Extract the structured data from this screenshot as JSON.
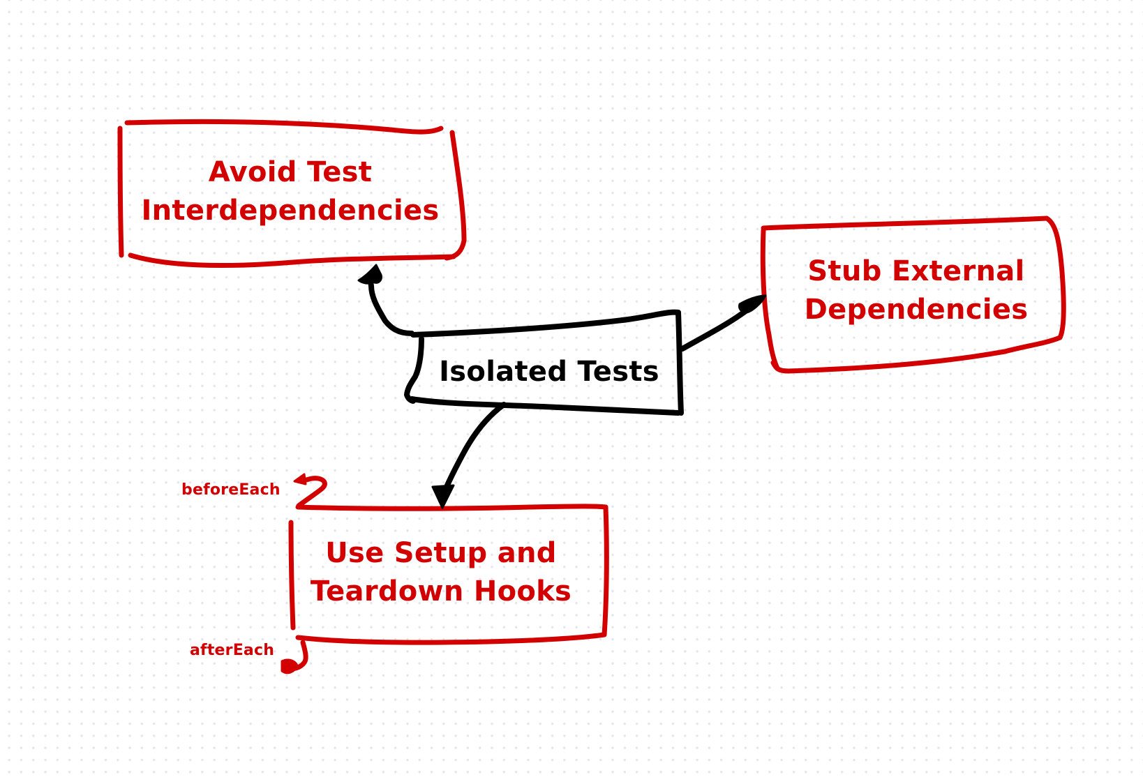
{
  "diagram": {
    "colors": {
      "accent": "#d20000",
      "center": "#000000",
      "background": "#ffffff",
      "grid_dot": "#e3e6ec"
    },
    "center_node": {
      "label": "Isolated Tests"
    },
    "nodes": [
      {
        "id": "avoid-interdependencies",
        "lines": [
          "Avoid Test",
          "Interdependencies"
        ]
      },
      {
        "id": "stub-external",
        "lines": [
          "Stub External",
          "Dependencies"
        ]
      },
      {
        "id": "setup-teardown",
        "lines": [
          "Use Setup and",
          "Teardown Hooks"
        ]
      }
    ],
    "annotations": {
      "before": "beforeEach",
      "after": "afterEach"
    },
    "edges": [
      {
        "from": "Isolated Tests",
        "to": "Avoid Test Interdependencies"
      },
      {
        "from": "Isolated Tests",
        "to": "Stub External Dependencies"
      },
      {
        "from": "Isolated Tests",
        "to": "Use Setup and Teardown Hooks"
      }
    ]
  }
}
